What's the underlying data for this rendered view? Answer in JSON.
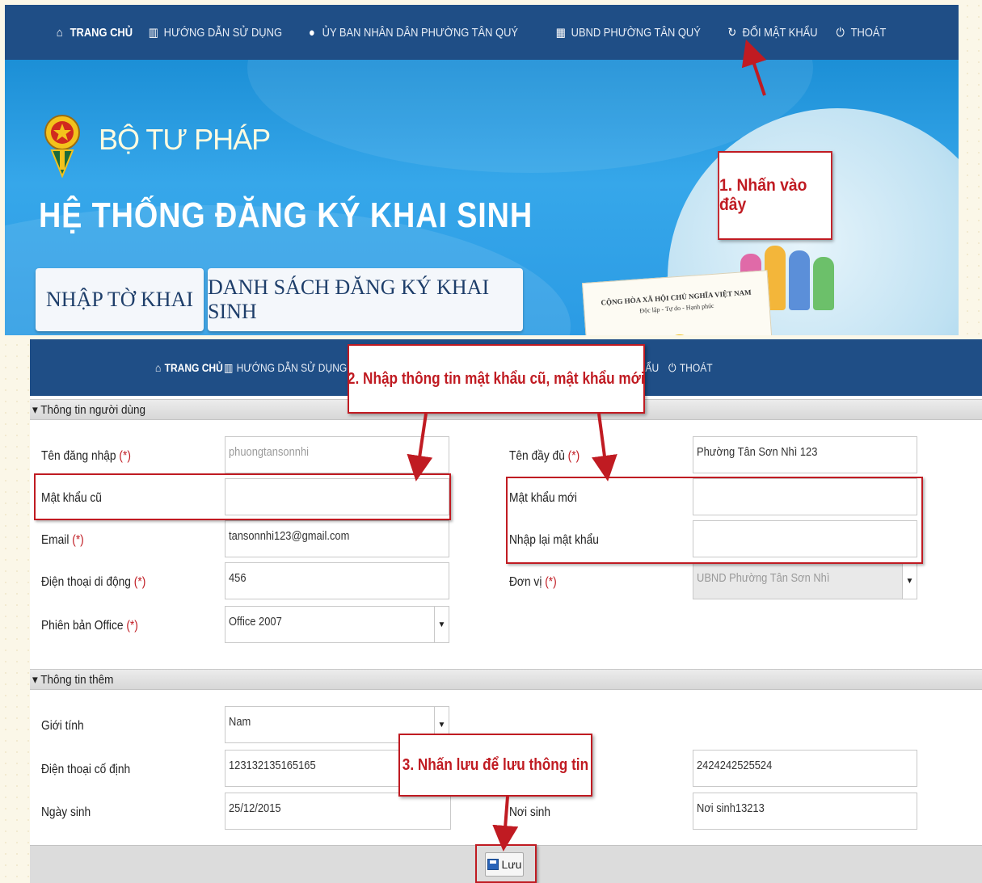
{
  "top_nav": {
    "home": "TRANG CHỦ",
    "guide": "HƯỚNG DẪN SỬ DỤNG",
    "committee": "ỦY BAN NHÂN DÂN PHƯỜNG TÂN QUÝ",
    "ubnd": "UBND PHƯỜNG TÂN QUÝ",
    "change_password": "ĐỔI MẬT KHẨU",
    "logout": "THOÁT"
  },
  "banner": {
    "org_name": "BỘ TƯ PHÁP",
    "system_title": "HỆ THỐNG ĐĂNG KÝ KHAI SINH",
    "btn_declare": "NHẬP TỜ KHAI",
    "btn_list": "DANH SÁCH ĐĂNG KÝ KHAI SINH",
    "cert_line1": "CỘNG HÒA XÃ HỘI CHỦ NGHĨA VIỆT NAM",
    "cert_line2": "Độc lập - Tự do - Hạnh phúc"
  },
  "callouts": {
    "step1": "1. Nhấn vào đây",
    "step2": "2. Nhập thông tin mật khẩu cũ, mật khẩu mới",
    "step3": "3. Nhấn lưu để lưu thông tin"
  },
  "bottom_nav": {
    "home": "TRANG CHỦ",
    "guide": "HƯỚNG DẪN SỬ DỤNG",
    "change_password": "ĐỔI MẬT KHẨU",
    "logout": "THOÁT"
  },
  "user_section": {
    "header": "Thông tin người dùng",
    "username_label": "Tên đăng nhập",
    "username_value": "phuongtansonnhi",
    "fullname_label": "Tên đầy đủ",
    "fullname_value": "Phường Tân Sơn Nhì 123",
    "old_password_label": "Mật khẩu cũ",
    "new_password_label": "Mật khẩu mới",
    "confirm_password_label": "Nhập lại mật khẩu",
    "email_label": "Email",
    "email_value": "tansonnhi123@gmail.com",
    "mobile_label": "Điện thoại di động",
    "mobile_value": "456",
    "unit_label": "Đơn vị",
    "unit_value": "UBND Phường Tân Sơn Nhì",
    "office_label": "Phiên bản Office",
    "office_value": "Office 2007",
    "required_mark": "(*)"
  },
  "extra_section": {
    "header": "Thông tin thêm",
    "gender_label": "Giới tính",
    "gender_value": "Nam",
    "landline_label": "Điện thoại cố định",
    "landline_value": "123132135165165",
    "landline_value2": "2424242525524",
    "birthdate_label": "Ngày sinh",
    "birthdate_value": "25/12/2015",
    "birthplace_label": "Nơi sinh",
    "birthplace_value": "Nơi sinh13213"
  },
  "save_button": "Lưu",
  "colors": {
    "nav_bg": "#1f4e86",
    "banner_blue": "#2b9be4",
    "annotation_red": "#c01b22"
  }
}
